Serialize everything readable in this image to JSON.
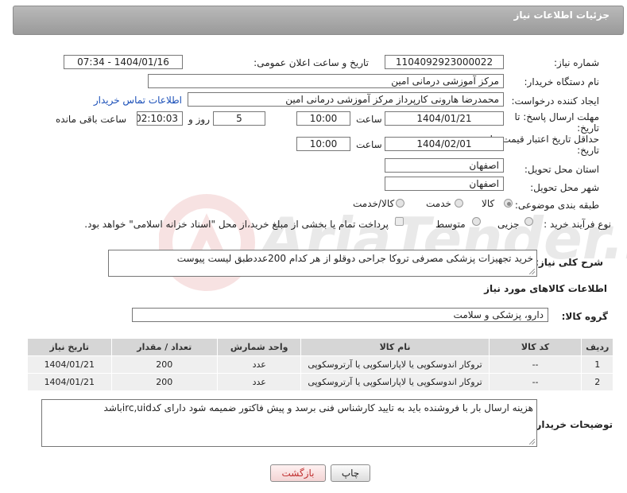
{
  "header": {
    "title": "جزئیات اطلاعات نیاز"
  },
  "fields": {
    "need_number_label": "شماره نیاز:",
    "need_number": "1104092923000022",
    "announce_label": "تاریخ و ساعت اعلان عمومی:",
    "announce_value": "1404/01/16 - 07:34",
    "buyer_org_label": "نام دستگاه خریدار:",
    "buyer_org": "مرکز آموزشی درمانی امین",
    "requester_label": "ایجاد کننده درخواست:",
    "requester": "محمدرضا هارونی کارپرداز مرکز آموزشی درمانی امین",
    "contact_link": "اطلاعات تماس خریدار",
    "deadline_label_1": "مهلت ارسال پاسخ: تا",
    "deadline_label_2": "تاریخ:",
    "deadline_date": "1404/01/21",
    "time_label": "ساعت",
    "deadline_time": "10:00",
    "days_value": "5",
    "days_label": "روز و",
    "remaining_time": "02:10:03",
    "remaining_label": "ساعت باقی مانده",
    "validity_label_1": "حداقل تاریخ اعتبار قیمت: تا",
    "validity_label_2": "تاریخ:",
    "validity_date": "1404/02/01",
    "validity_time": "10:00",
    "province_label": "استان محل تحویل:",
    "province": "اصفهان",
    "city_label": "شهر محل تحویل:",
    "city": "اصفهان",
    "category_label": "طبقه بندی موضوعی:",
    "category_options": [
      "کالا",
      "خدمت",
      "کالا/خدمت"
    ],
    "category_selected": "کالا",
    "process_label": "نوع فرآیند خرید :",
    "process_options": [
      "جزیی",
      "متوسط"
    ],
    "payment_note": "پرداخت تمام یا بخشی از مبلغ خرید،از محل \"اسناد خزانه اسلامی\" خواهد بود."
  },
  "description": {
    "label": "شرح کلی نیاز:",
    "text": "خرید تجهیزات پزشکی مصرفی تروکا جراحی دوقلو از هر کدام 200عددطبق لیست پیوست"
  },
  "goods": {
    "section_title": "اطلاعات کالاهای مورد نیاز",
    "group_label": "گروه کالا:",
    "group_value": "دارو، پزشکی و سلامت",
    "columns": [
      "ردیف",
      "کد کالا",
      "نام کالا",
      "واحد شمارش",
      "تعداد / مقدار",
      "تاریخ نیاز"
    ],
    "rows": [
      [
        "1",
        "--",
        "تروکار اندوسکوپی یا لاپاراسکوپی یا آرتروسکوپی",
        "عدد",
        "200",
        "1404/01/21"
      ],
      [
        "2",
        "--",
        "تروکار اندوسکوپی یا لاپاراسکوپی یا آرتروسکوپی",
        "عدد",
        "200",
        "1404/01/21"
      ]
    ]
  },
  "buyer_notes": {
    "label": "توضیحات خریدار:",
    "text": "هزینه ارسال بار با فروشنده باید به تایید کارشناس فنی برسد و پیش فاکتور ضمیمه شود دارای کدirc,uidباشد"
  },
  "buttons": {
    "print": "چاپ",
    "back": "بازگشت"
  },
  "watermark": {
    "text": "AriaTender.neT"
  }
}
